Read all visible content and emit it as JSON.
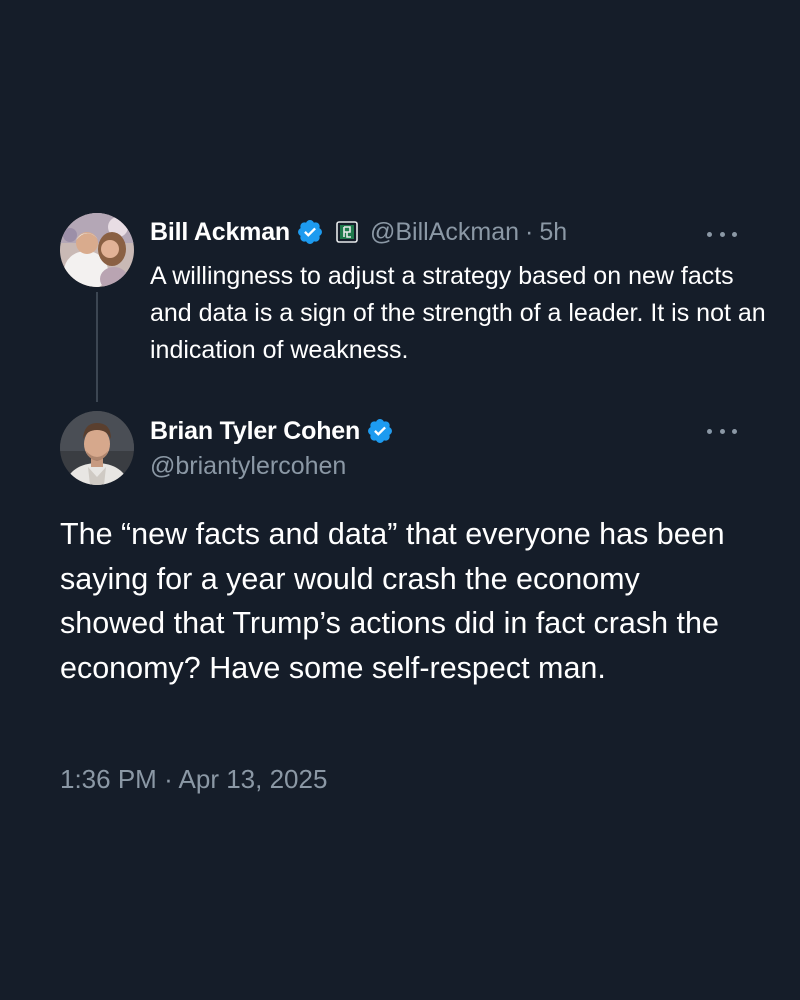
{
  "parent_tweet": {
    "display_name": "Bill Ackman",
    "handle": "@BillAckman",
    "separator": "·",
    "age": "5h",
    "text": "A willingness to adjust a strategy based on new facts and data is a sign of the strength of a leader. It is not an indication of weakness.",
    "verified_icon": "verified-badge-icon",
    "affiliation_icon": "affiliation-badge-icon",
    "more_icon": "more-options-icon"
  },
  "reply_tweet": {
    "display_name": "Brian Tyler Cohen",
    "handle": "@briantylercohen",
    "text": "The “new facts and data” that everyone has been saying for a year would crash the economy showed that Trump’s actions did in fact crash the economy? Have some self-respect man.",
    "time": "1:36 PM",
    "separator": "·",
    "date": "Apr 13, 2025",
    "verified_icon": "verified-badge-icon",
    "more_icon": "more-options-icon"
  },
  "colors": {
    "background": "#151d29",
    "primary_text": "#ffffff",
    "secondary_text": "#8b98a5",
    "verified_blue": "#1d9bf0",
    "thread_line": "#3c4652"
  }
}
